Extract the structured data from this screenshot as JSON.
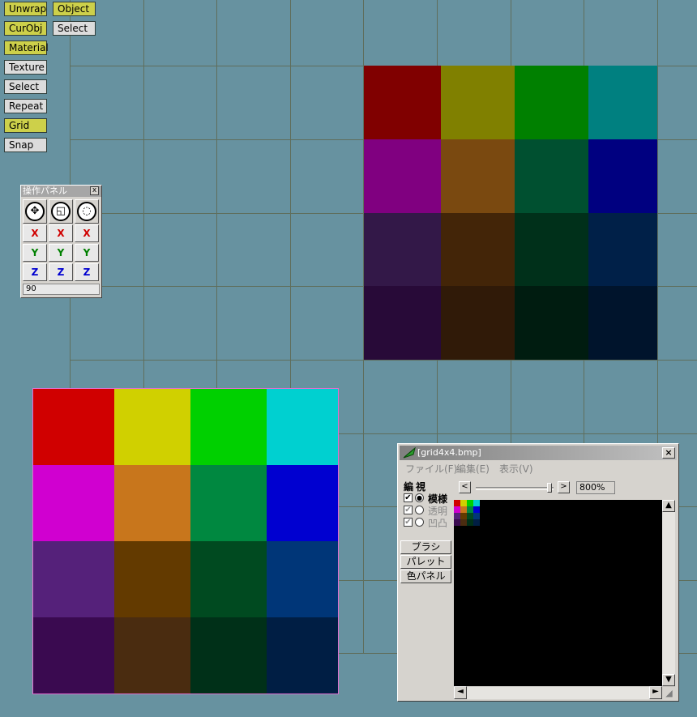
{
  "toolbar": {
    "col1": [
      {
        "label": "Unwrap",
        "on": true
      },
      {
        "label": "CurObj",
        "on": true
      },
      {
        "label": "Material",
        "on": true
      },
      {
        "label": "Texture",
        "on": false
      },
      {
        "label": "Select",
        "on": false
      },
      {
        "label": "Repeat",
        "on": false
      },
      {
        "label": "Grid",
        "on": true
      },
      {
        "label": "Snap",
        "on": false
      }
    ],
    "col2": [
      {
        "label": "Object",
        "on": true
      },
      {
        "label": "Select",
        "on": false
      }
    ]
  },
  "op_panel": {
    "title": "操作パネル",
    "close": "x",
    "axes": {
      "x": "X",
      "y": "Y",
      "z": "Z"
    },
    "value": "90"
  },
  "image_window": {
    "title": "[grid4x4.bmp]",
    "close": "×",
    "menus": [
      "ファイル(F)",
      "編集(E)",
      "表示(V)"
    ],
    "zoom": "800%",
    "mode_edit": "編",
    "mode_view": "視",
    "options": [
      {
        "label": "模様",
        "checked": true,
        "selected": true,
        "enabled": true
      },
      {
        "label": "透明",
        "checked": true,
        "selected": false,
        "enabled": false
      },
      {
        "label": "凹凸",
        "checked": true,
        "selected": false,
        "enabled": false
      }
    ],
    "side_buttons": [
      "ブラシ",
      "パレット",
      "色パネル"
    ],
    "scroll_left": "<",
    "scroll_right": ">"
  },
  "colors": {
    "background": "#6792a0",
    "button_on": "#cdd04a",
    "button_off": "#dcdcdc",
    "uv_texture": [
      [
        "#800000",
        "#808000",
        "#008000",
        "#008080"
      ],
      [
        "#800080",
        "#7a4910",
        "#005030",
        "#000080"
      ],
      [
        "#331848",
        "#432508",
        "#00301a",
        "#002048"
      ],
      [
        "#280a38",
        "#301a08",
        "#001c10",
        "#00142c"
      ]
    ],
    "palette": [
      [
        "#d00000",
        "#d0d000",
        "#00d000",
        "#00d0d0"
      ],
      [
        "#d000d0",
        "#c8761c",
        "#008840",
        "#0000d0"
      ],
      [
        "#55217a",
        "#633a00",
        "#004a20",
        "#003678"
      ],
      [
        "#3a0a50",
        "#4a2c10",
        "#003018",
        "#001e44"
      ]
    ]
  }
}
